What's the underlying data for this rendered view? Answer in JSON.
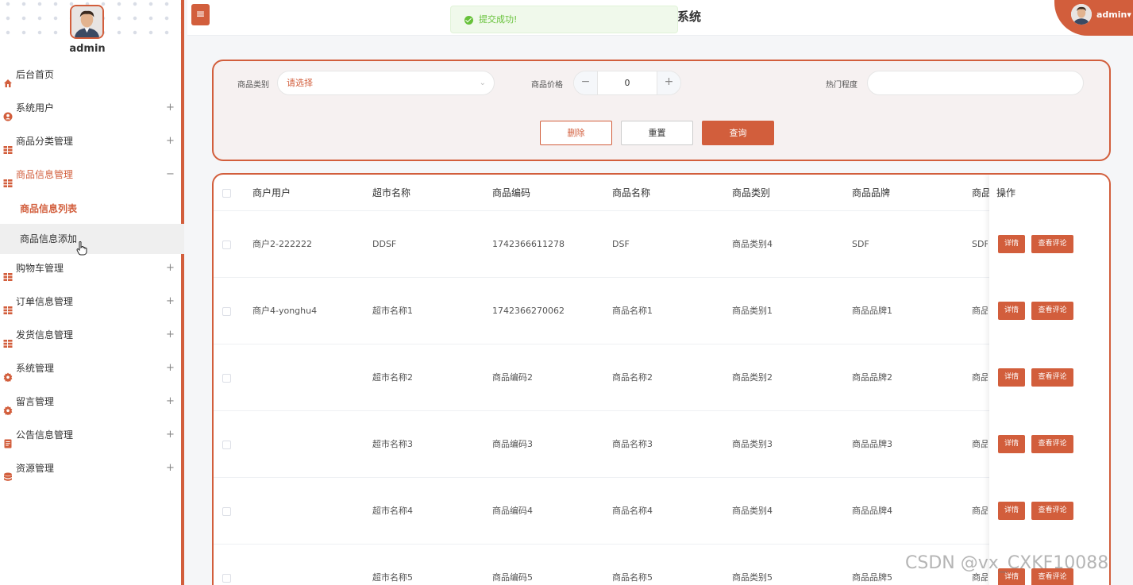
{
  "sidebar": {
    "username": "admin",
    "items": [
      {
        "label": "后台首页",
        "icon": "home-icon",
        "expandable": false
      },
      {
        "label": "系统用户",
        "icon": "user-icon",
        "expandable": true,
        "toggle": "+"
      },
      {
        "label": "商品分类管理",
        "icon": "grid-icon",
        "expandable": true,
        "toggle": "+"
      },
      {
        "label": "商品信息管理",
        "icon": "grid-icon",
        "expandable": true,
        "toggle": "−",
        "active": true
      },
      {
        "label": "购物车管理",
        "icon": "grid-icon",
        "expandable": true,
        "toggle": "+"
      },
      {
        "label": "订单信息管理",
        "icon": "grid-icon",
        "expandable": true,
        "toggle": "+"
      },
      {
        "label": "发货信息管理",
        "icon": "grid-icon",
        "expandable": true,
        "toggle": "+"
      },
      {
        "label": "系统管理",
        "icon": "gear-icon",
        "expandable": true,
        "toggle": "+"
      },
      {
        "label": "留言管理",
        "icon": "gear-icon",
        "expandable": true,
        "toggle": "+"
      },
      {
        "label": "公告信息管理",
        "icon": "document-icon",
        "expandable": true,
        "toggle": "+"
      },
      {
        "label": "资源管理",
        "icon": "database-icon",
        "expandable": true,
        "toggle": "+"
      }
    ],
    "subitems": [
      {
        "label": "商品信息列表",
        "active": true
      },
      {
        "label": "商品信息添加",
        "hover": true
      }
    ]
  },
  "header": {
    "menu_icon": "≡",
    "title_fragment": "系统",
    "toast": "提交成功!",
    "user": "admin",
    "user_caret": "▾"
  },
  "search": {
    "category_label": "商品类别",
    "category_placeholder": "请选择",
    "price_label": "商品价格",
    "price_value": "0",
    "minus": "−",
    "plus": "+",
    "hot_label": "热门程度",
    "hot_value": "",
    "delete_label": "删除",
    "reset_label": "重置",
    "query_label": "查询"
  },
  "table": {
    "headers": [
      "商户用户",
      "超市名称",
      "商品编码",
      "商品名称",
      "商品类别",
      "商品品牌",
      "商品",
      "操作"
    ],
    "detail_label": "详情",
    "comments_label": "查看评论",
    "rows": [
      {
        "merchant": "商户2-222222",
        "market": "DDSF",
        "code": "1742366611278",
        "name": "DSF",
        "category": "商品类别4",
        "brand": "SDF",
        "extra": "SDF"
      },
      {
        "merchant": "商户4-yonghu4",
        "market": "超市名称1",
        "code": "1742366270062",
        "name": "商品名称1",
        "category": "商品类别1",
        "brand": "商品品牌1",
        "extra": "商品"
      },
      {
        "merchant": "",
        "market": "超市名称2",
        "code": "商品编码2",
        "name": "商品名称2",
        "category": "商品类别2",
        "brand": "商品品牌2",
        "extra": "商品"
      },
      {
        "merchant": "",
        "market": "超市名称3",
        "code": "商品编码3",
        "name": "商品名称3",
        "category": "商品类别3",
        "brand": "商品品牌3",
        "extra": "商品"
      },
      {
        "merchant": "",
        "market": "超市名称4",
        "code": "商品编码4",
        "name": "商品名称4",
        "category": "商品类别4",
        "brand": "商品品牌4",
        "extra": "商品"
      },
      {
        "merchant": "",
        "market": "超市名称5",
        "code": "商品编码5",
        "name": "商品名称5",
        "category": "商品类别5",
        "brand": "商品品牌5",
        "extra": "商品"
      }
    ]
  },
  "watermark": "CSDN @vx_CXKF10088",
  "colors": {
    "accent": "#d25e3c",
    "success": "#67c23a"
  }
}
